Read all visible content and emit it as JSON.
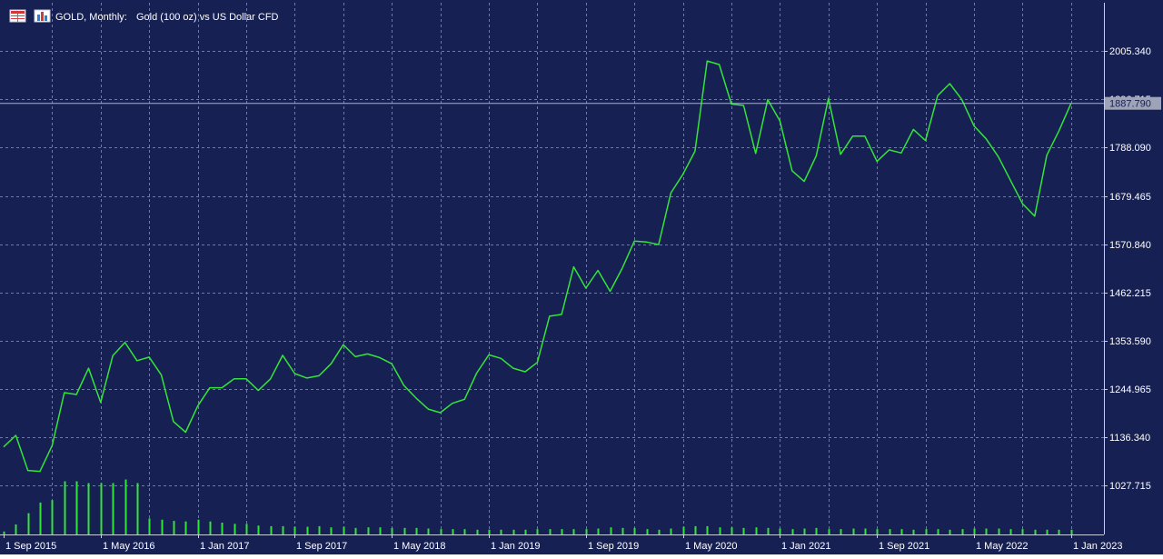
{
  "window": {
    "title_symbol": "GOLD, Monthly:",
    "title_description": "Gold (100 oz) vs US Dollar CFD",
    "icons": [
      "table-grid-icon",
      "chart-indicator-icon"
    ]
  },
  "colors": {
    "background": "#172052",
    "grid": "#6f7aa8",
    "price_line": "#33e43a",
    "volume_bars": "#33e43a",
    "axis_text": "#ffffff",
    "current_price_box": "#9ea3b7"
  },
  "chart_data": {
    "type": "line",
    "symbol": "GOLD",
    "timeframe": "Monthly",
    "ylim": [
      918.09,
      2114.0
    ],
    "y_ticks": [
      "2005.340",
      "1896.715",
      "1788.090",
      "1679.465",
      "1570.840",
      "1462.215",
      "1353.590",
      "1244.965",
      "1136.340",
      "1027.715"
    ],
    "x_ticks": [
      "1 Sep 2015",
      "1 May 2016",
      "1 Jan 2017",
      "1 Sep 2017",
      "1 May 2018",
      "1 Jan 2019",
      "1 Sep 2019",
      "1 May 2020",
      "1 Jan 2021",
      "1 Sep 2021",
      "1 May 2022",
      "1 Jan 2023"
    ],
    "x_tick_index": [
      0,
      8,
      16,
      24,
      32,
      40,
      48,
      56,
      64,
      72,
      80,
      88
    ],
    "current_price": "1887.790",
    "grid": true,
    "series": [
      {
        "kind": "close",
        "values": [
          1115,
          1141,
          1062,
          1060,
          1118,
          1237,
          1233,
          1292,
          1215,
          1320,
          1350,
          1309,
          1317,
          1277,
          1172,
          1148,
          1207,
          1248,
          1248,
          1268,
          1268,
          1242,
          1268,
          1321,
          1280,
          1270,
          1275,
          1302,
          1345,
          1318,
          1324,
          1316,
          1302,
          1253,
          1225,
          1200,
          1192,
          1213,
          1222,
          1281,
          1322,
          1314,
          1292,
          1284,
          1305,
          1409,
          1413,
          1520,
          1472,
          1512,
          1465,
          1517,
          1578,
          1576,
          1570,
          1686,
          1728,
          1780,
          1983,
          1975,
          1886,
          1883,
          1775,
          1896,
          1848,
          1736,
          1712,
          1770,
          1899,
          1773,
          1814,
          1814,
          1757,
          1783,
          1776,
          1829,
          1804,
          1905,
          1932,
          1896,
          1837,
          1808,
          1768,
          1715,
          1662,
          1634,
          1771,
          1826,
          1887.79
        ]
      },
      {
        "kind": "volume",
        "values": [
          5,
          17,
          36,
          54,
          58,
          90,
          90,
          87,
          87,
          87,
          93,
          87,
          27,
          25,
          23,
          22,
          25,
          22,
          20,
          18,
          18,
          15,
          14,
          14,
          13,
          13,
          14,
          12,
          13,
          11,
          12,
          12,
          11,
          11,
          11,
          10,
          9,
          9,
          9,
          8,
          8,
          8,
          8,
          8,
          9,
          9,
          9,
          9,
          9,
          10,
          12,
          11,
          11,
          9,
          8,
          10,
          13,
          14,
          14,
          12,
          12,
          11,
          12,
          11,
          10,
          9,
          10,
          11,
          9,
          9,
          10,
          10,
          9,
          9,
          9,
          8,
          9,
          9,
          8,
          9,
          10,
          10,
          10,
          9,
          9,
          8,
          8,
          8,
          8
        ]
      }
    ]
  }
}
